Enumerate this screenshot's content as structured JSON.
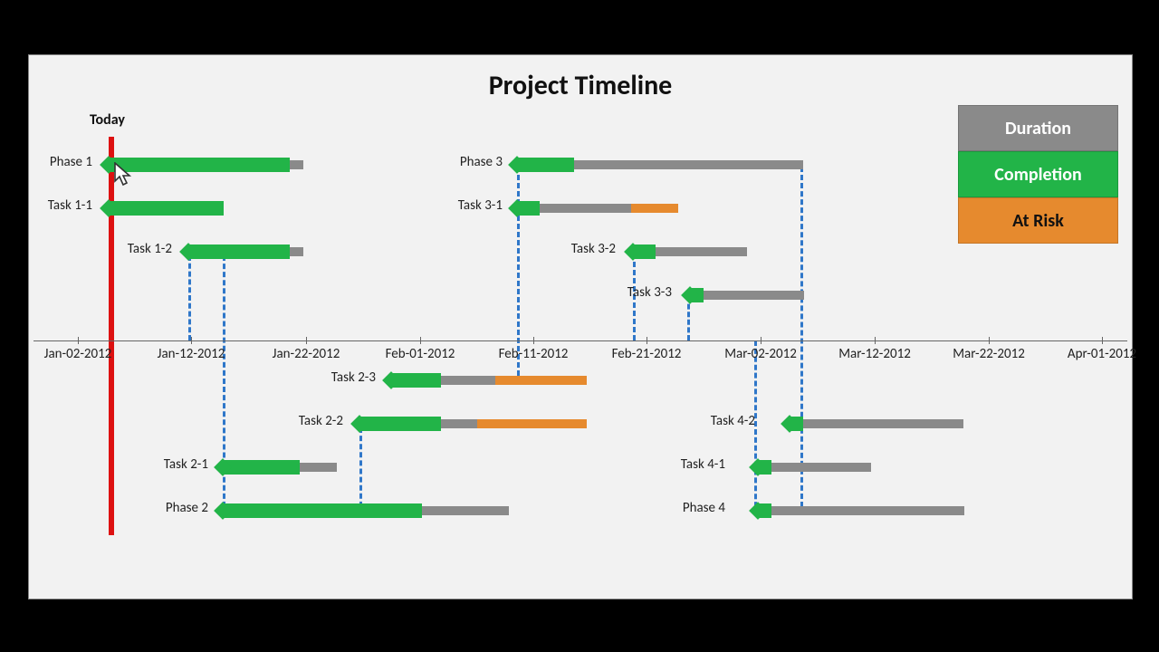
{
  "title": "Project Timeline",
  "today_label": "Today",
  "legend": {
    "duration": "Duration",
    "completion": "Completion",
    "risk": "At Risk"
  },
  "axis": [
    "Jan-02-2012",
    "Jan-12-2012",
    "Jan-22-2012",
    "Feb-01-2012",
    "Feb-11-2012",
    "Feb-21-2012",
    "Mar-02-2012",
    "Mar-12-2012",
    "Mar-22-2012",
    "Apr-01-2012"
  ],
  "today_date": "Jan-04-2012",
  "rows_top": {
    "phase1": "Phase 1",
    "task11": "Task 1-1",
    "task12": "Task 1-2",
    "phase3": "Phase 3",
    "task31": "Task 3-1",
    "task32": "Task 3-2",
    "task33": "Task 3-3"
  },
  "rows_bot": {
    "task23": "Task 2-3",
    "task22": "Task 2-2",
    "task21": "Task 2-1",
    "phase2": "Phase 2",
    "task42": "Task 4-2",
    "task41": "Task 4-1",
    "phase4": "Phase 4"
  },
  "chart_data": {
    "type": "bar",
    "title": "Project Timeline",
    "x_axis_unit": "date",
    "x_range": [
      "2012-01-02",
      "2012-04-01"
    ],
    "today": "2012-01-04",
    "legend": [
      "Duration",
      "Completion",
      "At Risk"
    ],
    "series": [
      {
        "name": "Phase 1",
        "start": "2012-01-04",
        "end": "2012-01-21",
        "completion_end": "2012-01-20",
        "risk": false
      },
      {
        "name": "Task 1-1",
        "start": "2012-01-04",
        "end": "2012-01-14",
        "completion_end": "2012-01-14",
        "risk": false
      },
      {
        "name": "Task 1-2",
        "start": "2012-01-11",
        "end": "2012-01-21",
        "completion_end": "2012-01-20",
        "risk": false
      },
      {
        "name": "Phase 3",
        "start": "2012-02-09",
        "end": "2012-03-05",
        "completion_end": "2012-02-14",
        "risk": false
      },
      {
        "name": "Task 3-1",
        "start": "2012-02-09",
        "end": "2012-02-23",
        "completion_end": "2012-02-11",
        "risk": true,
        "risk_start": "2012-02-20"
      },
      {
        "name": "Task 3-2",
        "start": "2012-02-20",
        "end": "2012-03-01",
        "completion_end": "2012-02-22",
        "risk": false
      },
      {
        "name": "Task 3-3",
        "start": "2012-02-25",
        "end": "2012-03-05",
        "completion_end": "2012-02-26",
        "risk": false
      },
      {
        "name": "Phase 2",
        "start": "2012-01-14",
        "end": "2012-02-08",
        "completion_end": "2012-02-01",
        "risk": false
      },
      {
        "name": "Task 2-1",
        "start": "2012-01-14",
        "end": "2012-01-24",
        "completion_end": "2012-01-21",
        "risk": false
      },
      {
        "name": "Task 2-2",
        "start": "2012-01-26",
        "end": "2012-02-15",
        "completion_end": "2012-02-02",
        "risk": true,
        "risk_start": "2012-02-06"
      },
      {
        "name": "Task 2-3",
        "start": "2012-01-29",
        "end": "2012-02-15",
        "completion_end": "2012-02-02",
        "risk": true,
        "risk_start": "2012-02-08"
      },
      {
        "name": "Phase 4",
        "start": "2012-03-02",
        "end": "2012-03-20",
        "completion_end": "2012-03-03",
        "risk": false
      },
      {
        "name": "Task 4-1",
        "start": "2012-03-02",
        "end": "2012-03-12",
        "completion_end": "2012-03-03",
        "risk": false
      },
      {
        "name": "Task 4-2",
        "start": "2012-03-05",
        "end": "2012-03-20",
        "completion_end": "2012-03-06",
        "risk": false
      }
    ],
    "dependencies": [
      [
        "Task 1-2",
        "Task 2-1"
      ],
      [
        "Task 2-1",
        "Task 2-2"
      ],
      [
        "Task 2-3",
        "Phase 3"
      ],
      [
        "Task 3-2",
        "Task 3-3"
      ],
      [
        "Phase 3",
        "Phase 4"
      ]
    ]
  }
}
